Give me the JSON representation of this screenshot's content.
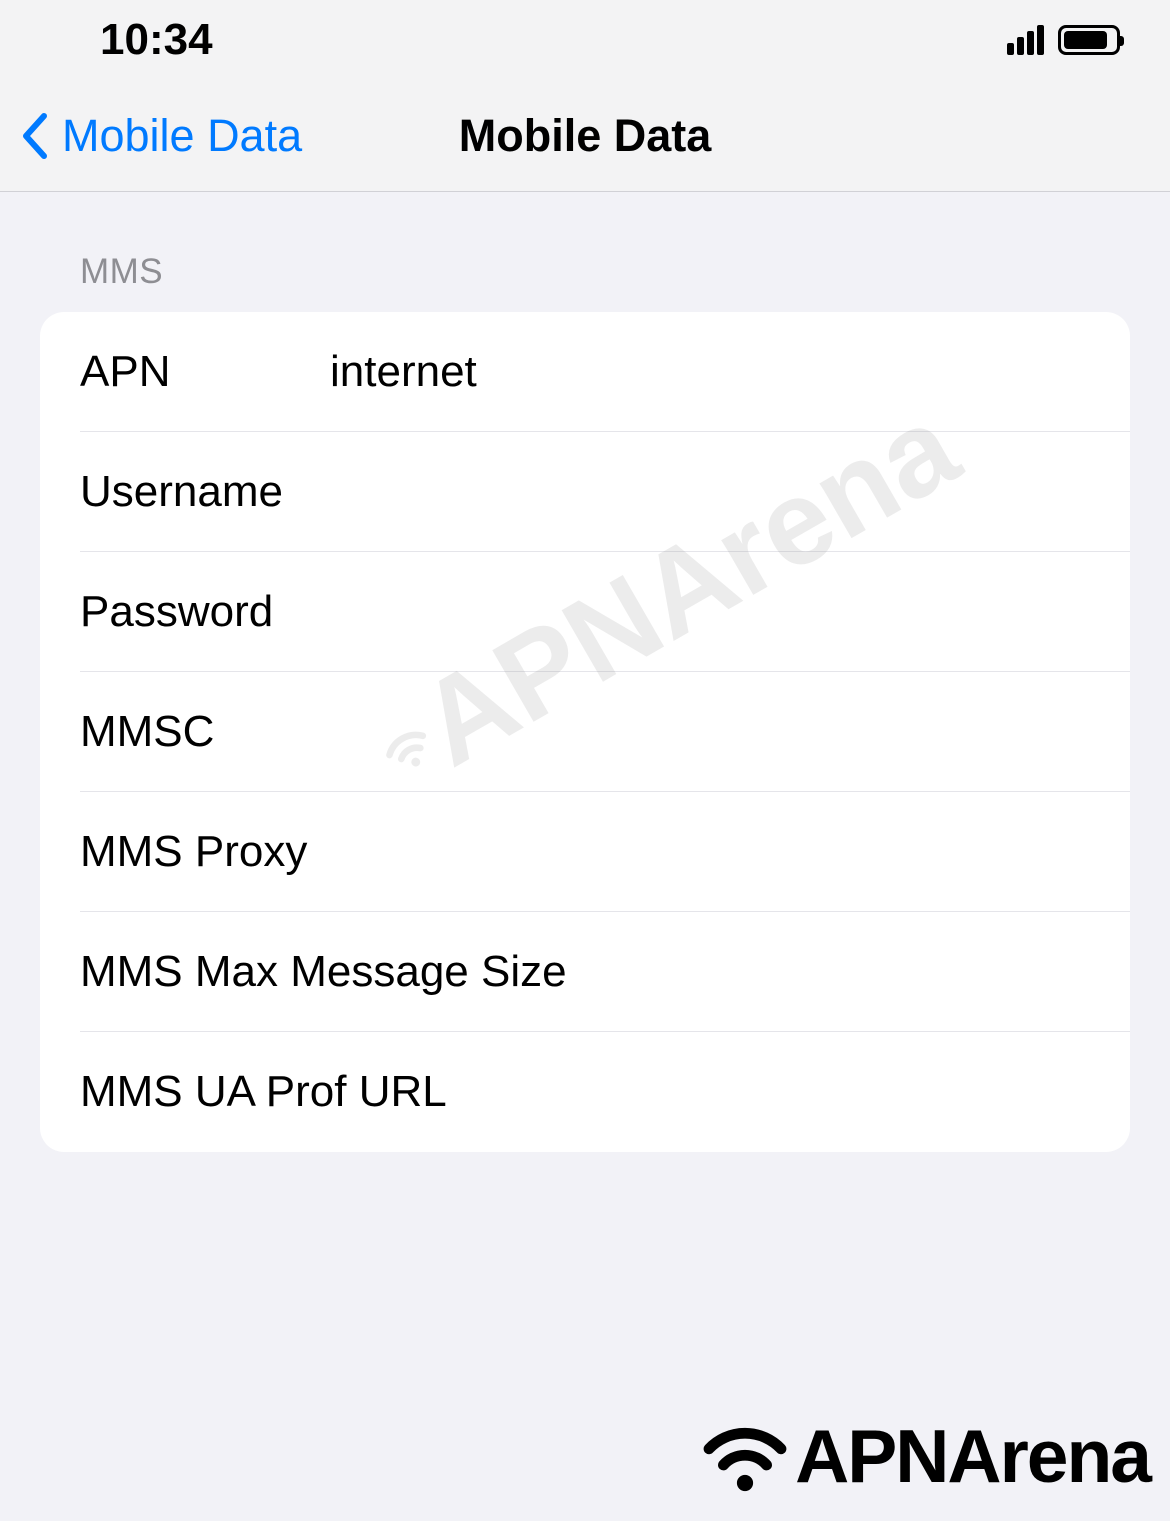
{
  "status": {
    "time": "10:34"
  },
  "nav": {
    "back_label": "Mobile Data",
    "title": "Mobile Data"
  },
  "section": {
    "header": "MMS",
    "rows": [
      {
        "label": "APN",
        "value": "internet"
      },
      {
        "label": "Username",
        "value": ""
      },
      {
        "label": "Password",
        "value": ""
      },
      {
        "label": "MMSC",
        "value": ""
      },
      {
        "label": "MMS Proxy",
        "value": ""
      },
      {
        "label": "MMS Max Message Size",
        "value": ""
      },
      {
        "label": "MMS UA Prof URL",
        "value": ""
      }
    ]
  },
  "watermark": {
    "text": "APNArena"
  }
}
